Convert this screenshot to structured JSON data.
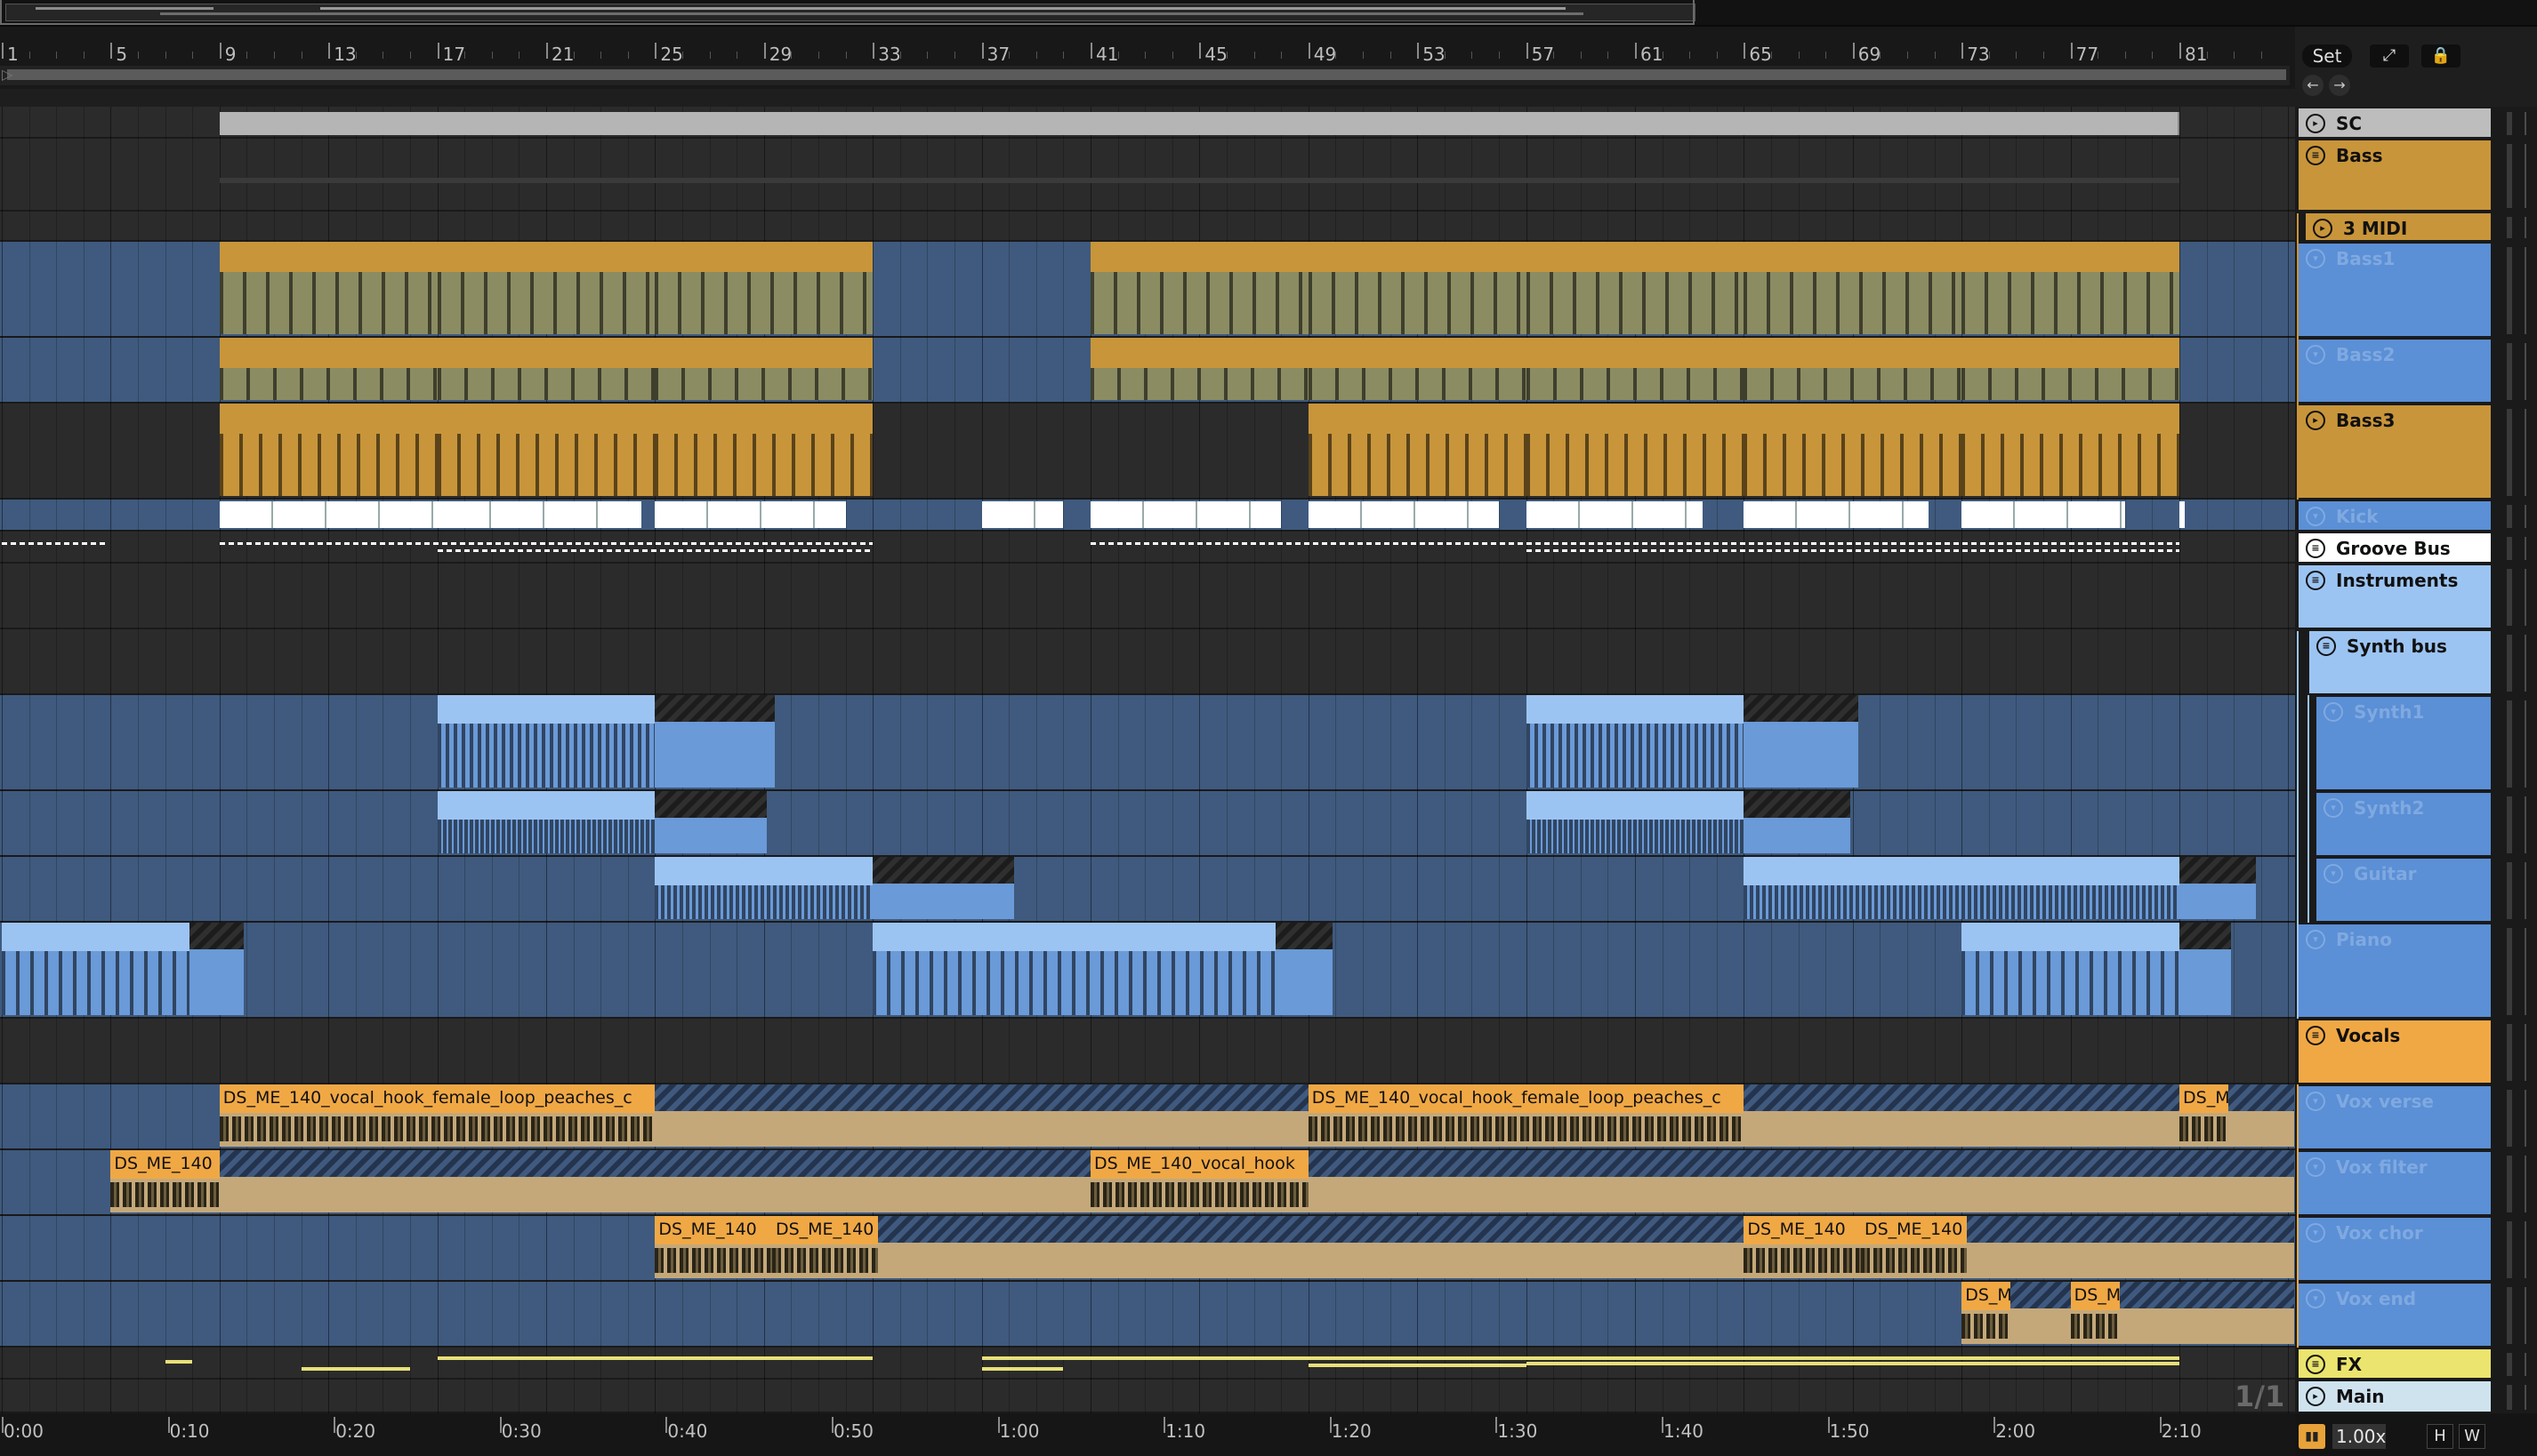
{
  "ruler": {
    "bars": [
      "1",
      "5",
      "9",
      "13",
      "17",
      "21",
      "25",
      "29",
      "33",
      "37",
      "41",
      "45",
      "49",
      "53",
      "57",
      "61",
      "65",
      "69",
      "73",
      "77",
      "81"
    ]
  },
  "toolbar": {
    "set_label": "Set",
    "expand_icon": "expand-icon",
    "lock_icon": "lock-icon",
    "back_icon": "arrow-left-icon",
    "forward_icon": "arrow-right-icon"
  },
  "tracks": [
    {
      "name": "SC",
      "color": "#bdbdbd",
      "type": "return",
      "dim": false
    },
    {
      "name": "Bass",
      "color": "#c8953a",
      "type": "group",
      "dim": false
    },
    {
      "name": "3 MIDI",
      "color": "#c8953a",
      "type": "midi",
      "dim": false
    },
    {
      "name": "Bass1",
      "color": "#6a9ad8",
      "type": "midi",
      "dim": true
    },
    {
      "name": "Bass2",
      "color": "#6a9ad8",
      "type": "midi",
      "dim": true
    },
    {
      "name": "Bass3",
      "color": "#c8953a",
      "type": "midi",
      "dim": false
    },
    {
      "name": "Kick",
      "color": "#6a9ad8",
      "type": "audio",
      "dim": true
    },
    {
      "name": "Groove Bus",
      "color": "#ffffff",
      "type": "group",
      "dim": false
    },
    {
      "name": "Instruments",
      "color": "#9cc4f2",
      "type": "group",
      "dim": false
    },
    {
      "name": "Synth bus",
      "color": "#9cc4f2",
      "type": "group",
      "dim": false
    },
    {
      "name": "Synth1",
      "color": "#6a9ad8",
      "type": "midi",
      "dim": true
    },
    {
      "name": "Synth2",
      "color": "#6a9ad8",
      "type": "midi",
      "dim": true
    },
    {
      "name": "Guitar",
      "color": "#6a9ad8",
      "type": "midi",
      "dim": true
    },
    {
      "name": "Piano",
      "color": "#6a9ad8",
      "type": "midi",
      "dim": true
    },
    {
      "name": "Vocals",
      "color": "#f0a845",
      "type": "group",
      "dim": false
    },
    {
      "name": "Vox verse",
      "color": "#6a9ad8",
      "type": "audio",
      "dim": true
    },
    {
      "name": "Vox filter",
      "color": "#6a9ad8",
      "type": "audio",
      "dim": true
    },
    {
      "name": "Vox chor",
      "color": "#6a9ad8",
      "type": "audio",
      "dim": true
    },
    {
      "name": "Vox end",
      "color": "#6a9ad8",
      "type": "audio",
      "dim": true
    },
    {
      "name": "FX",
      "color": "#ebe46e",
      "type": "group",
      "dim": false
    },
    {
      "name": "Main",
      "color": "#cfe3ef",
      "type": "master",
      "dim": false
    }
  ],
  "clips": {
    "vox_verse_1": "DS_ME_140_vocal_hook_female_loop_peaches_c",
    "vox_verse_2": "DS_ME_140_vocal_hook_female_loop_peaches_c",
    "vox_verse_3": "DS_M",
    "vox_filter_1": "DS_ME_140",
    "vox_filter_2": "DS_ME_140_vocal_hook",
    "vox_chor_1": "DS_ME_140",
    "vox_chor_2": "DS_ME_140",
    "vox_chor_3": "DS_ME_140",
    "vox_chor_4": "DS_ME_140",
    "vox_end_1": "DS_M",
    "vox_end_2": "DS_M"
  },
  "timeline": {
    "labels": [
      "0:00",
      "0:10",
      "0:20",
      "0:30",
      "0:40",
      "0:50",
      "1:00",
      "1:10",
      "1:20",
      "1:30",
      "1:40",
      "1:50",
      "2:00",
      "2:10"
    ]
  },
  "status": {
    "zoom_ratio": "1/1",
    "zoom_value": "1.00x",
    "h_label": "H",
    "w_label": "W"
  }
}
